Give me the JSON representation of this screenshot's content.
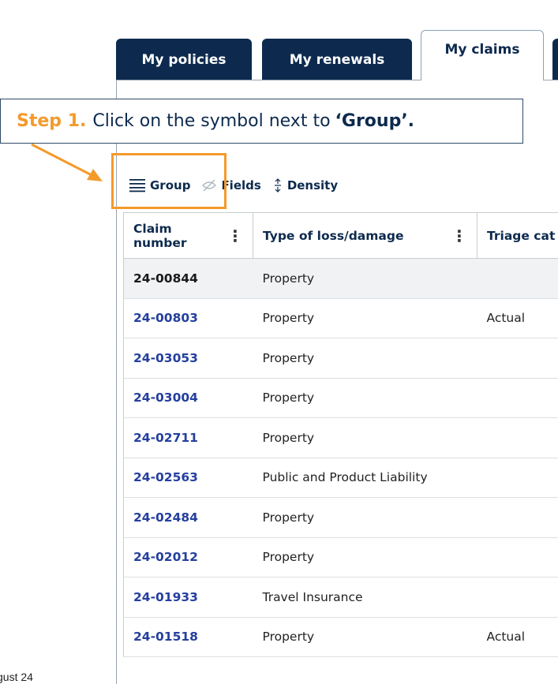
{
  "tabs": [
    {
      "label": "My policies",
      "active": false
    },
    {
      "label": "My renewals",
      "active": false
    },
    {
      "label": "My claims",
      "active": true
    }
  ],
  "callout": {
    "step": "Step 1.",
    "text": "Click on the symbol next to",
    "quoted": "‘Group’."
  },
  "toolbar": {
    "group": "Group",
    "fields": "Fields",
    "density": "Density"
  },
  "table": {
    "columns": [
      "Claim number",
      "Type of loss/damage",
      "Triage cat"
    ],
    "rows": [
      {
        "claim": "24-00844",
        "type": "Property",
        "triage": ""
      },
      {
        "claim": "24-00803",
        "type": "Property",
        "triage": "Actual"
      },
      {
        "claim": "24-03053",
        "type": "Property",
        "triage": ""
      },
      {
        "claim": "24-03004",
        "type": "Property",
        "triage": ""
      },
      {
        "claim": "24-02711",
        "type": "Property",
        "triage": ""
      },
      {
        "claim": "24-02563",
        "type": "Public and Product Liability",
        "triage": ""
      },
      {
        "claim": "24-02484",
        "type": "Property",
        "triage": ""
      },
      {
        "claim": "24-02012",
        "type": "Property",
        "triage": ""
      },
      {
        "claim": "24-01933",
        "type": "Travel Insurance",
        "triage": ""
      },
      {
        "claim": "24-01518",
        "type": "Property",
        "triage": "Actual"
      }
    ]
  },
  "footer": {
    "text": "gust 24"
  },
  "colors": {
    "navy": "#0d2a4e",
    "accent": "#f39a2b",
    "link": "#243f9e"
  }
}
